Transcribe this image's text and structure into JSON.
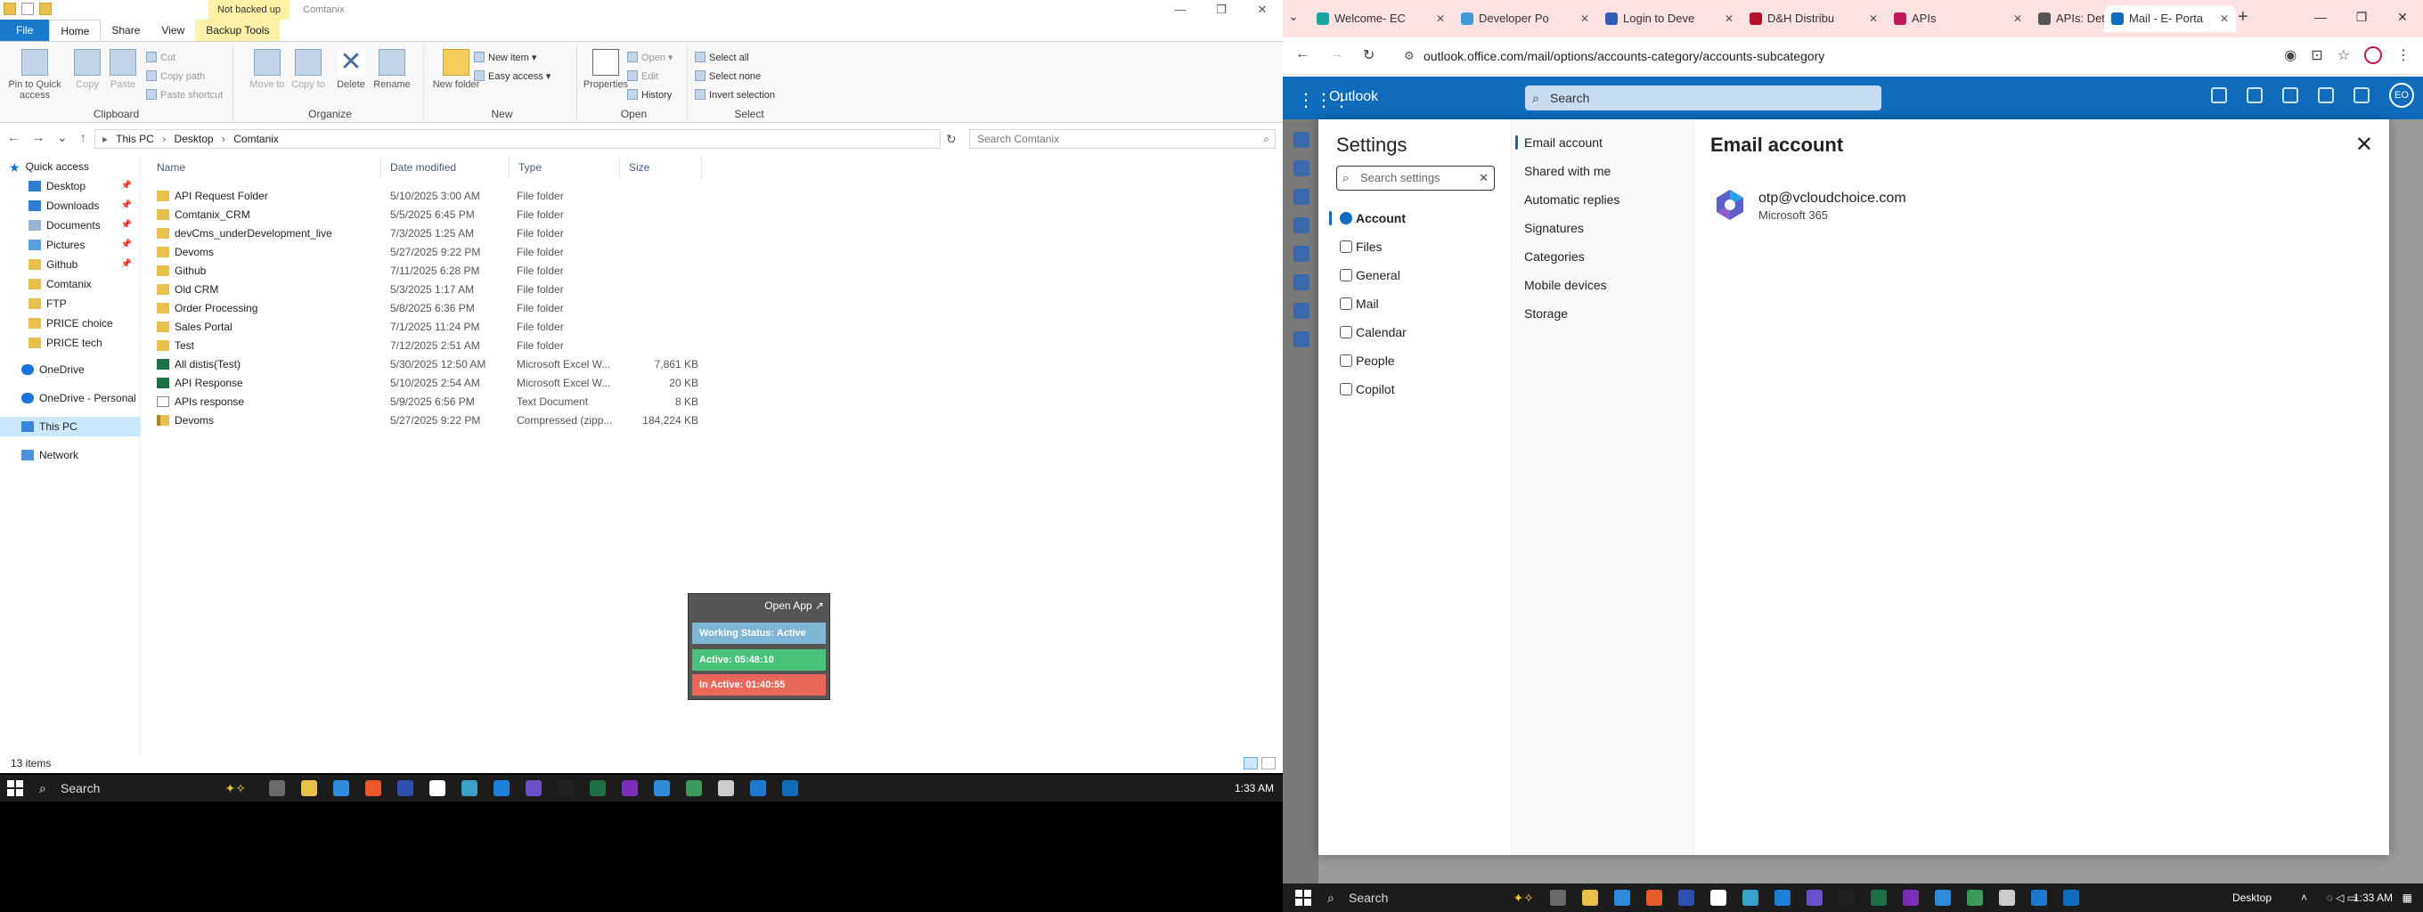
{
  "explorer": {
    "backup_tab": "Not backed up",
    "window_title": "Comtanix",
    "ribbon_tabs": [
      "File",
      "Home",
      "Share",
      "View",
      "Backup Tools"
    ],
    "ribbon": {
      "pin": "Pin to Quick access",
      "copy": "Copy",
      "paste": "Paste",
      "cut": "Cut",
      "copy_path": "Copy path",
      "paste_shortcut": "Paste shortcut",
      "clipboard": "Clipboard",
      "move_to": "Move to",
      "copy_to": "Copy to",
      "delete": "Delete",
      "rename": "Rename",
      "organize": "Organize",
      "new_folder": "New folder",
      "new_item": "New item",
      "easy_access": "Easy access",
      "new": "New",
      "properties": "Properties",
      "open": "Open",
      "edit": "Edit",
      "history": "History",
      "open_group": "Open",
      "select_all": "Select all",
      "select_none": "Select none",
      "invert_selection": "Invert selection",
      "select_group": "Select"
    },
    "breadcrumb": [
      "This PC",
      "Desktop",
      "Comtanix"
    ],
    "search_placeholder": "Search Comtanix",
    "nav": [
      {
        "label": "Quick access",
        "icon": "star-icon",
        "pin": false
      },
      {
        "label": "Desktop",
        "icon": "desktop-icon",
        "pin": true
      },
      {
        "label": "Downloads",
        "icon": "downloads-icon",
        "pin": true
      },
      {
        "label": "Documents",
        "icon": "documents-icon",
        "pin": true
      },
      {
        "label": "Pictures",
        "icon": "pictures-icon",
        "pin": true
      },
      {
        "label": "Github",
        "icon": "folder-icon",
        "pin": true
      },
      {
        "label": "Comtanix",
        "icon": "folder-icon",
        "pin": false
      },
      {
        "label": "FTP",
        "icon": "folder-icon",
        "pin": false
      },
      {
        "label": "PRICE choice",
        "icon": "folder-icon",
        "pin": false
      },
      {
        "label": "PRICE tech",
        "icon": "folder-icon",
        "pin": false
      },
      {
        "label": "OneDrive",
        "icon": "cloud-icon",
        "pin": false
      },
      {
        "label": "OneDrive - Personal",
        "icon": "cloud-icon",
        "pin": false
      },
      {
        "label": "This PC",
        "icon": "computer-icon",
        "pin": false
      },
      {
        "label": "Network",
        "icon": "network-icon",
        "pin": false
      }
    ],
    "columns": {
      "name": "Name",
      "date": "Date modified",
      "type": "Type",
      "size": "Size"
    },
    "files": [
      {
        "name": "API Request Folder",
        "date": "5/10/2025 3:00 AM",
        "type": "File folder",
        "size": "",
        "icon": "folder"
      },
      {
        "name": "Comtanix_CRM",
        "date": "5/5/2025 6:45 PM",
        "type": "File folder",
        "size": "",
        "icon": "folder"
      },
      {
        "name": "devCms_underDevelopment_live",
        "date": "7/3/2025 1:25 AM",
        "type": "File folder",
        "size": "",
        "icon": "folder"
      },
      {
        "name": "Devoms",
        "date": "5/27/2025 9:22 PM",
        "type": "File folder",
        "size": "",
        "icon": "folder"
      },
      {
        "name": "Github",
        "date": "7/11/2025 6:28 PM",
        "type": "File folder",
        "size": "",
        "icon": "folder"
      },
      {
        "name": "Old CRM",
        "date": "5/3/2025 1:17 AM",
        "type": "File folder",
        "size": "",
        "icon": "folder"
      },
      {
        "name": "Order Processing",
        "date": "5/8/2025 6:36 PM",
        "type": "File folder",
        "size": "",
        "icon": "folder"
      },
      {
        "name": "Sales Portal",
        "date": "7/1/2025 11:24 PM",
        "type": "File folder",
        "size": "",
        "icon": "folder"
      },
      {
        "name": "Test",
        "date": "7/12/2025 2:51 AM",
        "type": "File folder",
        "size": "",
        "icon": "folder"
      },
      {
        "name": "All distis(Test)",
        "date": "5/30/2025 12:50 AM",
        "type": "Microsoft Excel W...",
        "size": "7,861 KB",
        "icon": "excel"
      },
      {
        "name": "API Response",
        "date": "5/10/2025 2:54 AM",
        "type": "Microsoft Excel W...",
        "size": "20 KB",
        "icon": "excel"
      },
      {
        "name": "APIs response",
        "date": "5/9/2025 6:56 PM",
        "type": "Text Document",
        "size": "8 KB",
        "icon": "text"
      },
      {
        "name": "Devoms",
        "date": "5/27/2025 9:22 PM",
        "type": "Compressed (zipp...",
        "size": "184,224 KB",
        "icon": "zip"
      }
    ],
    "status": "13 items",
    "widget": {
      "open_app": "Open App ↗",
      "working_status": "Working Status: Active",
      "active": "Active: 05:48:10",
      "inactive": "In Active: 01:40:55"
    }
  },
  "taskbar_left": {
    "search": "Search",
    "clock": "1:33 AM"
  },
  "taskbar_right": {
    "search": "Search",
    "desktop": "Desktop",
    "clock": "1:33 AM"
  },
  "browser": {
    "tabs": [
      {
        "title": "Welcome- EC",
        "color": "#19a7a0"
      },
      {
        "title": "Developer Po",
        "color": "#3d9ad6"
      },
      {
        "title": "Login to Deve",
        "color": "#2b5fb8"
      },
      {
        "title": "D&H Distribu",
        "color": "#b0122c"
      },
      {
        "title": "APIs",
        "color": "#c2185b"
      },
      {
        "title": "APIs: Details -",
        "color": "#555555"
      },
      {
        "title": "Mail - E- Porta",
        "color": "#0f6cbd"
      }
    ],
    "url": "outlook.office.com/mail/options/accounts-category/accounts-subcategory"
  },
  "outlook": {
    "brand": "Outlook",
    "search": "Search",
    "avatar": "EO",
    "settings_title": "Settings",
    "settings_search_placeholder": "Search settings",
    "categories": [
      "Account",
      "Files",
      "General",
      "Mail",
      "Calendar",
      "People",
      "Copilot"
    ],
    "subcategories": [
      "Email account",
      "Shared with me",
      "Automatic replies",
      "Signatures",
      "Categories",
      "Mobile devices",
      "Storage"
    ],
    "content_title": "Email account",
    "account_email": "otp@vcloudchoice.com",
    "account_plan": "Microsoft 365"
  }
}
